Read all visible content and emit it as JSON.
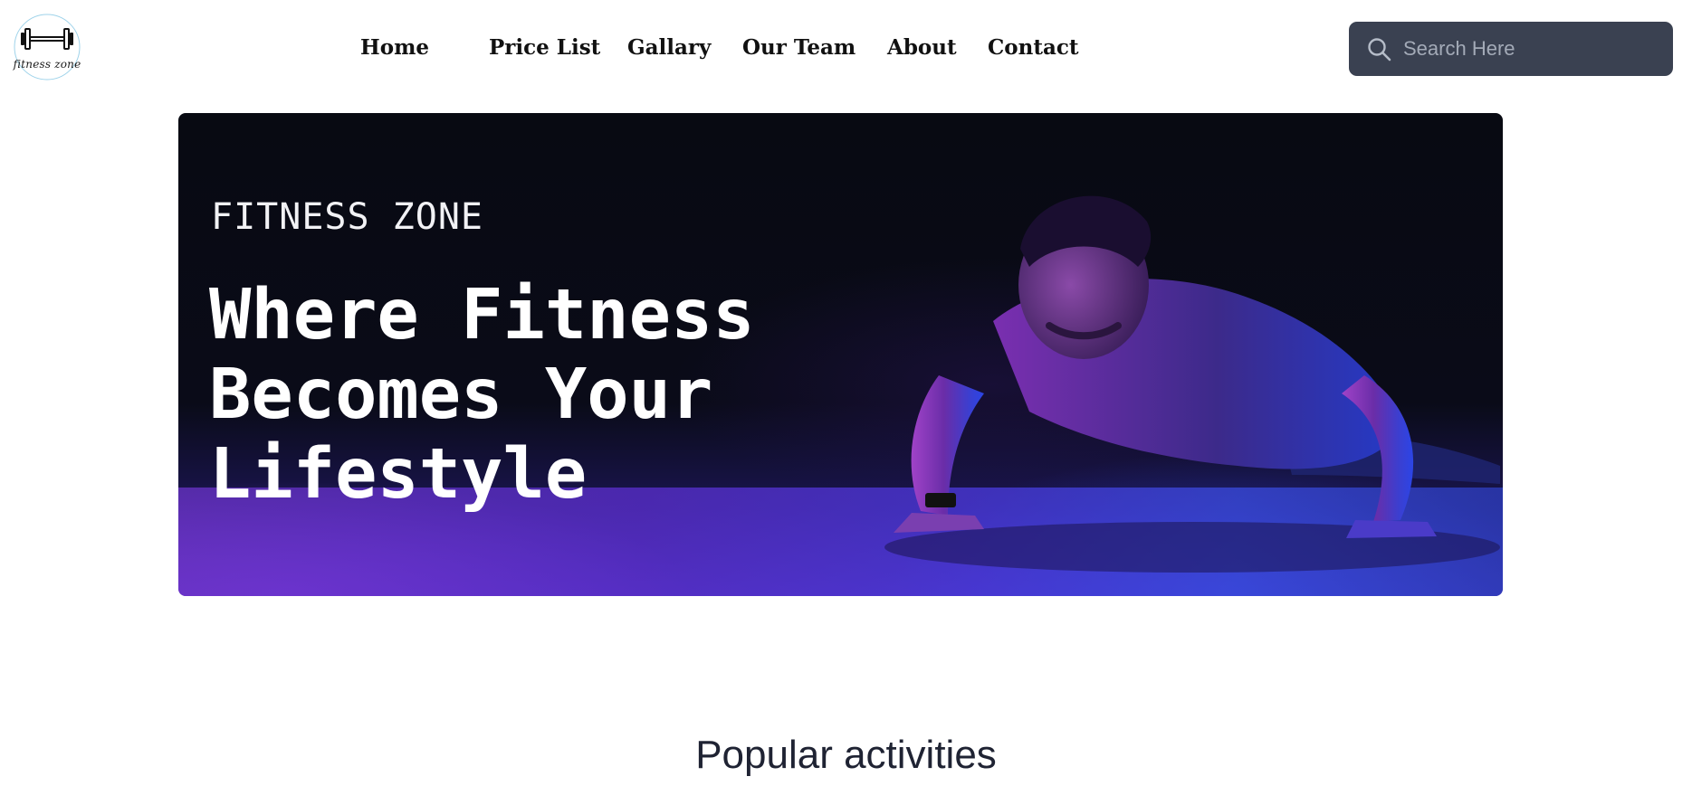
{
  "brand": {
    "logo_text": "fitness zone",
    "logo_icon": "dumbbell-icon"
  },
  "nav": {
    "items": [
      {
        "label": "Home"
      },
      {
        "label": "Price List"
      },
      {
        "label": "Gallary"
      },
      {
        "label": "Our Team"
      },
      {
        "label": "About"
      },
      {
        "label": "Contact"
      }
    ]
  },
  "search": {
    "placeholder": "Search Here",
    "value": "",
    "icon": "search-icon"
  },
  "hero": {
    "kicker": "FITNESS ZONE",
    "title": "Where Fitness Becomes Your Lifestyle",
    "image": "man-doing-pushup-photo"
  },
  "section": {
    "title": "Popular activities"
  },
  "colors": {
    "search_bg": "#3a4151",
    "hero_text": "#ffffff",
    "accent_purple": "#6a33c9",
    "accent_blue": "#3a4be0"
  }
}
